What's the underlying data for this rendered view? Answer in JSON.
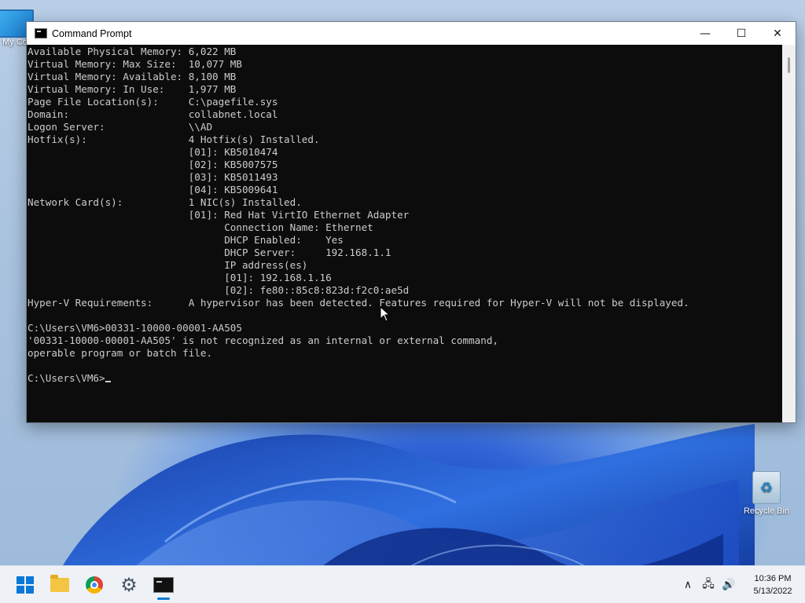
{
  "desktop": {
    "icons": [
      {
        "label": "My Co"
      },
      {
        "label": "Recycle Bin"
      }
    ]
  },
  "window": {
    "title": "Command Prompt",
    "controls": {
      "minimize": "—",
      "maximize": "☐",
      "close": "✕"
    },
    "console_lines": [
      "Available Physical Memory: 6,022 MB",
      "Virtual Memory: Max Size:  10,077 MB",
      "Virtual Memory: Available: 8,100 MB",
      "Virtual Memory: In Use:    1,977 MB",
      "Page File Location(s):     C:\\pagefile.sys",
      "Domain:                    collabnet.local",
      "Logon Server:              \\\\AD",
      "Hotfix(s):                 4 Hotfix(s) Installed.",
      "                           [01]: KB5010474",
      "                           [02]: KB5007575",
      "                           [03]: KB5011493",
      "                           [04]: KB5009641",
      "Network Card(s):           1 NIC(s) Installed.",
      "                           [01]: Red Hat VirtIO Ethernet Adapter",
      "                                 Connection Name: Ethernet",
      "                                 DHCP Enabled:    Yes",
      "                                 DHCP Server:     192.168.1.1",
      "                                 IP address(es)",
      "                                 [01]: 192.168.1.16",
      "                                 [02]: fe80::85c8:823d:f2c0:ae5d",
      "Hyper-V Requirements:      A hypervisor has been detected. Features required for Hyper-V will not be displayed.",
      "",
      "C:\\Users\\VM6>00331-10000-00001-AA505",
      "'00331-10000-00001-AA505' is not recognized as an internal or external command,",
      "operable program or batch file.",
      ""
    ],
    "prompt": "C:\\Users\\VM6>"
  },
  "taskbar": {
    "apps": [
      {
        "name": "Start",
        "icon": "windows-logo-icon"
      },
      {
        "name": "File Explorer",
        "icon": "folder-icon"
      },
      {
        "name": "Google Chrome",
        "icon": "chrome-icon"
      },
      {
        "name": "Settings",
        "icon": "gear-icon"
      },
      {
        "name": "Command Prompt",
        "icon": "cmd-icon",
        "active": true
      }
    ],
    "tray": {
      "chevron": "∧",
      "network": "🖧",
      "volume": "🔊"
    },
    "clock": {
      "time": "10:36 PM",
      "date": "5/13/2022"
    }
  },
  "colors": {
    "accent": "#0a78d7",
    "console_bg": "#0c0c0c",
    "console_fg": "#cccccc"
  }
}
